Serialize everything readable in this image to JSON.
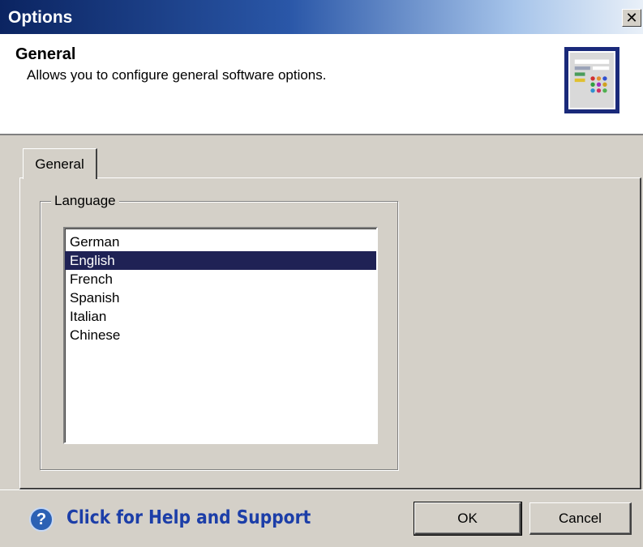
{
  "window": {
    "title": "Options",
    "close_label": "✕"
  },
  "header": {
    "title": "General",
    "description": "Allows you to configure general software options.",
    "icon": "settings-window-icon"
  },
  "tabs": [
    {
      "label": "General",
      "active": true
    }
  ],
  "language_group": {
    "legend": "Language",
    "items": [
      "German",
      "English",
      "French",
      "Spanish",
      "Italian",
      "Chinese"
    ],
    "selected": "English"
  },
  "footer": {
    "help_text": "Click for Help and Support",
    "help_icon": "question-icon",
    "ok_label": "OK",
    "cancel_label": "Cancel"
  },
  "colors": {
    "title_bar_start": "#0b2461",
    "selection": "#1f2255",
    "help_link": "#1c3ea8"
  }
}
